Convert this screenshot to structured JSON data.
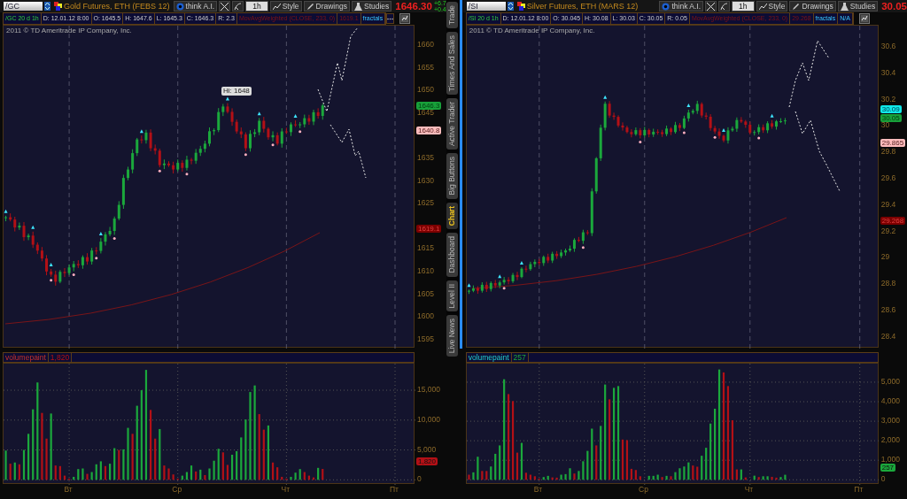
{
  "panels": [
    {
      "symbol": "/GC",
      "title": "Gold Futures, ETH (FEBS 12)",
      "think_ai": "think A.I.",
      "aggregation": "1h",
      "style": "Style",
      "drawings": "Drawings",
      "studies": "Studies",
      "last_price": "1646.30",
      "changes": [
        "+6.7",
        "+0.4"
      ],
      "info": [
        {
          "kind": "symbol",
          "text": "/GC 20 d 1h"
        },
        {
          "kind": "field",
          "text": "D: 12.01.12 8:00"
        },
        {
          "kind": "field",
          "text": "O: 1645.5"
        },
        {
          "kind": "field",
          "text": "H: 1647.6"
        },
        {
          "kind": "field",
          "text": "L: 1645.3"
        },
        {
          "kind": "field",
          "text": "C: 1646.3"
        },
        {
          "kind": "field",
          "text": "R: 2.3"
        },
        {
          "kind": "study",
          "text": "MovAvgWeighted (CLOSE, 233, 0)"
        },
        {
          "kind": "study_value",
          "text": "1619.1"
        },
        {
          "kind": "fractals",
          "text": "fractals"
        }
      ],
      "copyright": "2011 © TD Ameritrade IP Company, Inc.",
      "hi_label": "Hi: 1648",
      "price_axis": [
        "1660",
        "1655",
        "1650",
        "1645",
        "1635",
        "1630",
        "1625",
        "1615",
        "1610",
        "1605",
        "1600",
        "1595"
      ],
      "price_badges": [
        {
          "kind": "last",
          "text": "1646.3"
        },
        {
          "kind": "pivot",
          "text": "1640.8"
        },
        {
          "kind": "study",
          "text": "1619.1"
        }
      ],
      "volume": {
        "title": "volumepaint",
        "value": "1,820",
        "badge": "1,820",
        "chart_data": {
          "type": "bar",
          "categories": [
            null,
            null,
            null,
            null,
            null,
            null,
            null,
            null,
            null,
            null,
            null,
            null,
            null,
            null,
            "Вт",
            null,
            null,
            null,
            null,
            null,
            null,
            null,
            null,
            null,
            null,
            null,
            null,
            null,
            null,
            null,
            null,
            null,
            null,
            null,
            null,
            null,
            null,
            null,
            "Ср",
            null,
            null,
            null,
            null,
            null,
            null,
            null,
            null,
            null,
            null,
            null,
            null,
            null,
            null,
            null,
            null,
            null,
            null,
            null,
            null,
            null,
            null,
            null,
            "Чт",
            null,
            null,
            null,
            null,
            null,
            null,
            null,
            null,
            null,
            null,
            null,
            null,
            null,
            null,
            null,
            null,
            null,
            null,
            null,
            null,
            null,
            null,
            null,
            "Пт",
            null,
            null,
            null,
            null
          ],
          "ylim": [
            -840,
            19450
          ],
          "grid": true,
          "yticks": [
            {
              "value": 0,
              "label": "0"
            },
            {
              "value": 5000,
              "label": "5,000"
            },
            {
              "value": 10000,
              "label": "10,000"
            },
            {
              "value": 15000,
              "label": "15,000"
            }
          ],
          "series": [
            {
              "color": "#1ba83c",
              "values": [
                4900,
                null,
                2900,
                null,
                5000,
                7700,
                11800,
                16300,
                null,
                null,
                11100,
                null,
                null,
                null,
                null,
                500,
                1800,
                1900,
                null,
                1300,
                2600,
                3100,
                null,
                2700,
                5300,
                null,
                5100,
                8700,
                null,
                12400,
                15000,
                18400,
                null,
                null,
                8500,
                null,
                null,
                null,
                null,
                700,
                1300,
                2400,
                null,
                1700,
                null,
                1900,
                3200,
                5200,
                null,
                null,
                4200,
                4800,
                7100,
                10100,
                14700,
                15800,
                null,
                null,
                9100,
                null,
                null,
                null,
                null,
                500,
                1200,
                1800,
                null,
                null,
                null,
                2000,
                null,
                null,
                null,
                null,
                null,
                null,
                null,
                null,
                null,
                null,
                null,
                null,
                null,
                null,
                null,
                null,
                null,
                null,
                null,
                null,
                null
              ]
            },
            {
              "color": "#b31016",
              "values": [
                null,
                2700,
                null,
                2600,
                null,
                null,
                null,
                null,
                11200,
                6900,
                null,
                2400,
                2300,
                700,
                200,
                null,
                null,
                null,
                1000,
                null,
                null,
                null,
                2300,
                null,
                null,
                5000,
                null,
                null,
                7700,
                null,
                null,
                null,
                11700,
                6900,
                null,
                2400,
                1900,
                900,
                200,
                null,
                null,
                null,
                1400,
                null,
                800,
                null,
                null,
                null,
                4600,
                2500,
                null,
                null,
                null,
                null,
                null,
                null,
                11000,
                8400,
                null,
                2900,
                2100,
                500,
                200,
                null,
                null,
                null,
                1300,
                700,
                400,
                null,
                1820,
                null,
                null,
                null,
                null,
                null,
                null,
                null,
                null,
                null,
                null,
                null,
                null,
                null,
                null,
                null,
                null,
                null,
                null,
                null,
                null
              ]
            }
          ]
        }
      }
    },
    {
      "symbol": "/SI",
      "title": "Silver Futures, ETH (MARS 12)",
      "think_ai": "think A.I.",
      "aggregation": "1h",
      "style": "Style",
      "drawings": "Drawings",
      "studies": "Studies",
      "last_price": "30.05",
      "info": [
        {
          "kind": "symbol",
          "text": "/SI 20 d 1h"
        },
        {
          "kind": "field",
          "text": "D: 12.01.12 8:00"
        },
        {
          "kind": "field",
          "text": "O: 30.045"
        },
        {
          "kind": "field",
          "text": "H: 30.08"
        },
        {
          "kind": "field",
          "text": "L: 30.03"
        },
        {
          "kind": "field",
          "text": "C: 30.05"
        },
        {
          "kind": "field",
          "text": "R: 0.05"
        },
        {
          "kind": "study",
          "text": "MovAvgWeighted (CLOSE, 233, 0)"
        },
        {
          "kind": "study_value",
          "text": "29.268"
        },
        {
          "kind": "fractals",
          "text": "fractals"
        },
        {
          "kind": "fractals",
          "text": "N/A"
        }
      ],
      "copyright": "2011 © TD Ameritrade IP Company, Inc.",
      "price_axis": [
        "30.6",
        "30.4",
        "30.2",
        "30",
        "29.8",
        "29.6",
        "29.4",
        "29.2",
        "29",
        "28.8",
        "28.6",
        "28.4"
      ],
      "price_badges": [
        {
          "kind": "ask",
          "text": "30.09"
        },
        {
          "kind": "last",
          "text": "30.05"
        },
        {
          "kind": "pivot",
          "text": "29.865"
        },
        {
          "kind": "study",
          "text": "29.268"
        }
      ],
      "volume": {
        "title": "volumepaint",
        "value": "257",
        "badge": "257",
        "chart_data": {
          "type": "bar",
          "categories": [
            null,
            null,
            null,
            null,
            null,
            null,
            null,
            null,
            null,
            null,
            null,
            null,
            null,
            null,
            null,
            null,
            "Вт",
            null,
            null,
            null,
            null,
            null,
            null,
            null,
            null,
            null,
            null,
            null,
            null,
            null,
            null,
            null,
            null,
            null,
            null,
            null,
            null,
            null,
            null,
            null,
            "Ср",
            null,
            null,
            null,
            null,
            null,
            null,
            null,
            null,
            null,
            null,
            null,
            null,
            null,
            null,
            null,
            null,
            null,
            null,
            null,
            null,
            null,
            null,
            null,
            "Чт",
            null,
            null,
            null,
            null,
            null,
            null,
            null,
            null,
            null,
            null,
            null,
            null,
            null,
            null,
            null,
            null,
            null,
            null,
            null,
            null,
            null,
            null,
            null,
            null,
            "Пт",
            null,
            null,
            null,
            null
          ],
          "ylim": [
            -260,
            5950
          ],
          "grid": true,
          "yticks": [
            {
              "value": 0,
              "label": "0"
            },
            {
              "value": 1000,
              "label": "1,000"
            },
            {
              "value": 2000,
              "label": "2,000"
            },
            {
              "value": 3000,
              "label": "3,000"
            },
            {
              "value": 4000,
              "label": "4,000"
            },
            {
              "value": 5000,
              "label": "5,000"
            }
          ],
          "series": [
            {
              "color": "#1ba83c",
              "values": [
                null,
                380,
                1180,
                null,
                null,
                680,
                1330,
                1760,
                5150,
                null,
                null,
                null,
                1890,
                null,
                null,
                null,
                null,
                140,
                200,
                null,
                null,
                260,
                290,
                590,
                null,
                450,
                950,
                1480,
                2620,
                null,
                2760,
                4880,
                null,
                4710,
                4800,
                null,
                null,
                null,
                null,
                null,
                null,
                200,
                200,
                260,
                null,
                200,
                null,
                390,
                590,
                680,
                890,
                null,
                null,
                1230,
                1640,
                2880,
                3640,
                5650,
                null,
                null,
                null,
                null,
                530,
                null,
                null,
                210,
                null,
                180,
                180,
                null,
                null,
                140,
                257,
                null,
                null,
                null,
                null,
                null,
                null,
                null,
                null,
                null,
                null,
                null,
                null,
                null,
                null,
                null,
                null,
                null,
                null,
                null,
                null,
                null
              ]
            },
            {
              "color": "#b31016",
              "values": [
                260,
                null,
                null,
                450,
                450,
                null,
                null,
                null,
                null,
                4390,
                4030,
                1390,
                null,
                360,
                260,
                180,
                60,
                null,
                null,
                120,
                110,
                null,
                null,
                null,
                320,
                null,
                null,
                null,
                null,
                1760,
                null,
                null,
                4120,
                null,
                null,
                2060,
                2030,
                560,
                500,
                180,
                null,
                null,
                null,
                null,
                140,
                null,
                180,
                null,
                null,
                null,
                null,
                730,
                670,
                null,
                null,
                null,
                null,
                null,
                5500,
                4800,
                3050,
                530,
                null,
                120,
                null,
                null,
                140,
                null,
                null,
                150,
                110,
                null,
                null,
                null,
                null,
                null,
                null,
                null,
                null,
                null,
                null,
                null,
                null,
                null,
                null,
                null,
                null,
                null,
                null,
                null,
                null,
                null,
                null,
                null
              ]
            }
          ]
        }
      }
    }
  ],
  "side_tabs": [
    {
      "label": "Trade",
      "selected": false
    },
    {
      "label": "Times And Sales",
      "selected": false
    },
    {
      "label": "Active Trader",
      "selected": false
    },
    {
      "label": "Big Buttons",
      "selected": false
    },
    {
      "label": "Chart",
      "selected": true
    },
    {
      "label": "Dashboard",
      "selected": false
    },
    {
      "label": "Level II",
      "selected": false
    },
    {
      "label": "Live News",
      "selected": false
    }
  ]
}
